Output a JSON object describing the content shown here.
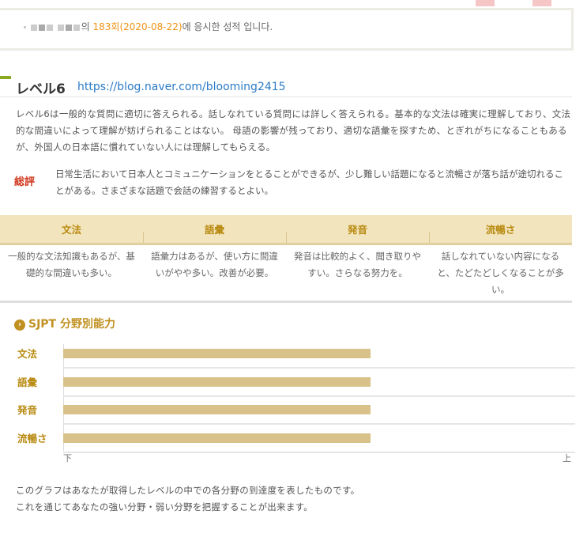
{
  "header": {
    "suffix": "의 ",
    "session": "183회(2020-08-22)",
    "tail": "에 응시한 성적 입니다."
  },
  "level": {
    "title": "レベル6",
    "url": "https://blog.naver.com/blooming2415",
    "description": "レベル6は一般的な質問に適切に答えられる。話しなれている質問には詳しく答えられる。基本的な文法は確実に理解しており、文法的な間違いによって理解が妨げられることはない。 母語の影響が残っており、適切な語彙を探すため、とぎれがちになることもあるが、外国人の日本語に慣れていない人には理解してもらえる。",
    "summary_label": "総評",
    "summary": "日常生活において日本人とコミュニケーションをとることができるが、少し難しい話題になると流暢さが落ち話が途切れることがある。さまざまな話題で会話の練習するとよい。"
  },
  "table": {
    "headers": [
      "文法",
      "語彙",
      "発音",
      "流暢さ"
    ],
    "cells": [
      "一般的な文法知識もあるが、基礎的な間違いも多い。",
      "語彙力はあるが、使い方に間違いがやや多い。改善が必要。",
      "発音は比較的よく、聞き取りやすい。さらなる努力を。",
      "話しなれていない内容になると、たどたどしくなることが多い。"
    ]
  },
  "chart_data": {
    "type": "bar",
    "title": "SJPT 分野別能力",
    "categories": [
      "文法",
      "語彙",
      "発音",
      "流暢さ"
    ],
    "values": [
      60,
      60,
      60,
      60
    ],
    "ylim": [
      0,
      100
    ],
    "xmin_label": "下",
    "xmax_label": "上",
    "bar_color": "#d8c28a"
  },
  "footer": [
    "このグラフはあなたが取得したレベルの中での各分野の到達度を表したものです。",
    "これを通じてあなたの強い分野・弱い分野を把握することが出来ます。"
  ]
}
